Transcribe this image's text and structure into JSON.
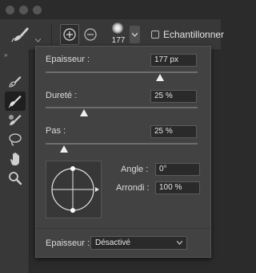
{
  "options_bar": {
    "brush_size_value": "177",
    "sample_label": "Echantillonner",
    "sample_checked": false
  },
  "tools": [
    {
      "name": "spot-healing-brush",
      "icon": "bandage-brush-icon",
      "selected": false
    },
    {
      "name": "brush",
      "icon": "brush-icon",
      "selected": true
    },
    {
      "name": "color-replacement",
      "icon": "color-brush-icon",
      "selected": false
    },
    {
      "name": "lasso",
      "icon": "lasso-icon",
      "selected": false
    },
    {
      "name": "hand",
      "icon": "hand-icon",
      "selected": false
    },
    {
      "name": "zoom",
      "icon": "zoom-icon",
      "selected": false
    }
  ],
  "panel": {
    "epaisseur_label": "Epaisseur :",
    "epaisseur_value": "177 px",
    "epaisseur_fraction": 0.75,
    "durete_label": "Dureté :",
    "durete_value": "25 %",
    "durete_fraction": 0.25,
    "pas_label": "Pas :",
    "pas_value": "25 %",
    "pas_fraction": 0.12,
    "angle_label": "Angle :",
    "angle_value": "0°",
    "arrondi_label": "Arrondi :",
    "arrondi_value": "100 %",
    "pressure_label": "Epaisseur :",
    "pressure_value": "Désactivé"
  },
  "colors": {
    "panel_bg": "#424242",
    "toolbar_bg": "#383838",
    "field_bg": "#2a2a2a"
  }
}
